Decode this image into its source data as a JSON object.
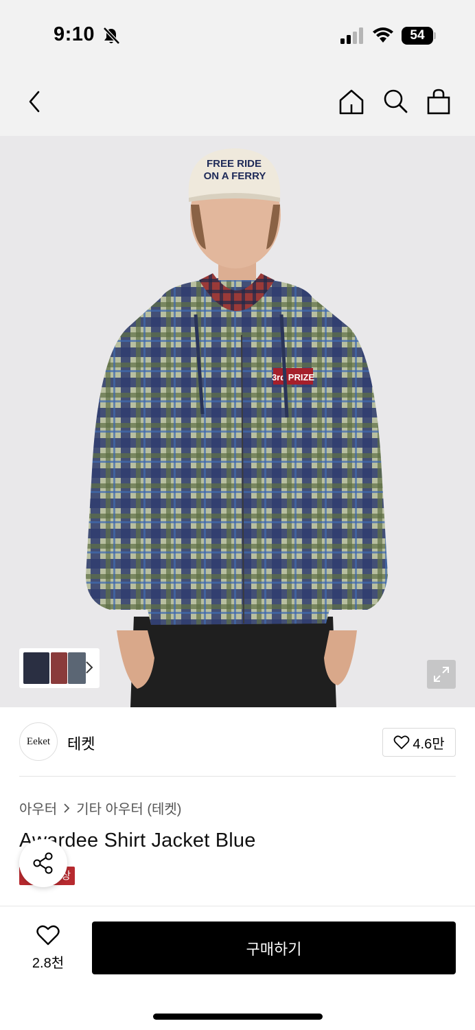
{
  "status_bar": {
    "time": "9:10",
    "battery_level": "54",
    "icons": [
      "bell-slash-icon",
      "cellular-signal-icon",
      "wifi-icon",
      "battery-icon"
    ]
  },
  "nav": {
    "icons": [
      "back-chevron-icon",
      "home-icon",
      "search-icon",
      "shopping-bag-icon"
    ]
  },
  "hero": {
    "cap_text_line1": "FREE RIDE",
    "cap_text_line2": "ON A FERRY",
    "patch_text": "3rd PRIZE"
  },
  "brand": {
    "logo_text": "Eeket",
    "name": "테켓",
    "like_count": "4.6만"
  },
  "breadcrumb": {
    "level1": "아우터",
    "level2": "기타 아우터 (테켓)"
  },
  "product": {
    "title": "Awardee Shirt Jacket Blue",
    "title_visible": "A    rdee Shirt Jacket Blue",
    "badge": "상"
  },
  "bottom_bar": {
    "wish_count": "2.8천",
    "buy_label": "구매하기"
  },
  "colors": {
    "buy_button": "#000000",
    "badge": "#b72a2f",
    "nav_bg": "#f2f2f2"
  }
}
